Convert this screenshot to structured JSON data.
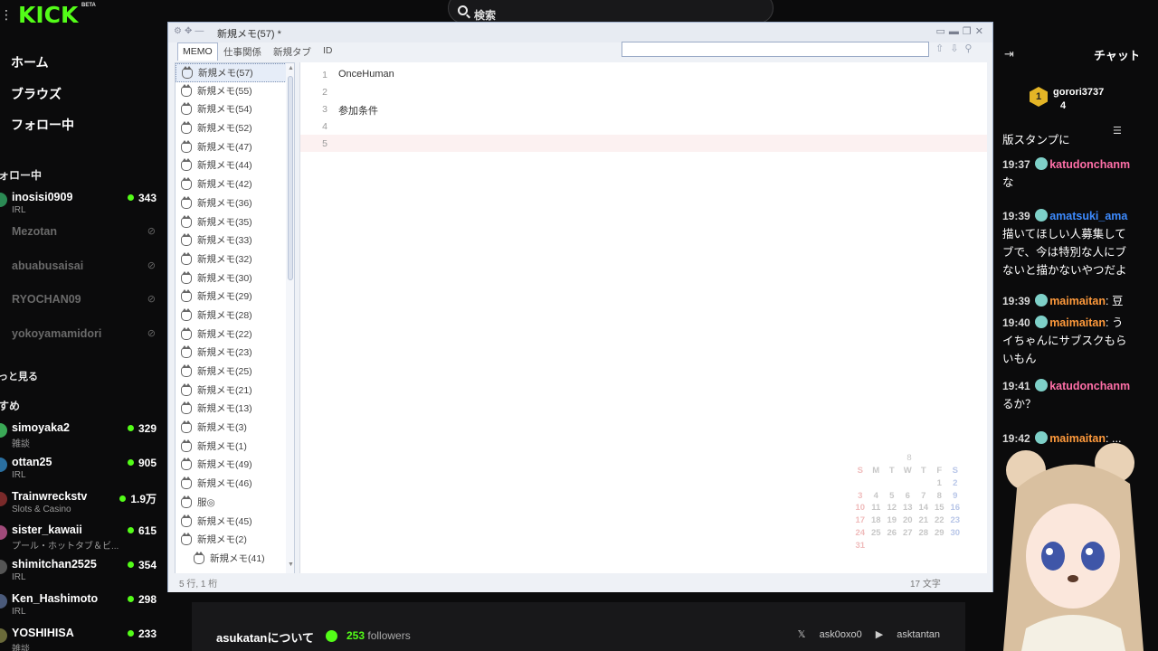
{
  "kick": {
    "logo": "KICK",
    "beta": "BETA",
    "nav": [
      "ホーム",
      "ブラウズ",
      "フォロー中"
    ],
    "following_title": "ォロー中",
    "following": [
      {
        "name": "inosisi0909",
        "category": "IRL",
        "viewers": "343",
        "live": true
      },
      {
        "name": "Mezotan",
        "live": false
      },
      {
        "name": "abuabusaisai",
        "live": false
      },
      {
        "name": "RYOCHAN09",
        "live": false
      },
      {
        "name": "yokoyamamidori",
        "live": false
      }
    ],
    "show_more": "っと見る",
    "recommended_title": "すめ",
    "recommended": [
      {
        "name": "simoyaka2",
        "category": "雑談",
        "viewers": "329"
      },
      {
        "name": "ottan25",
        "category": "IRL",
        "viewers": "905"
      },
      {
        "name": "Trainwreckstv",
        "category": "Slots & Casino",
        "viewers": "1.9万"
      },
      {
        "name": "sister_kawaii",
        "category": "プール・ホットタブ＆ビ...",
        "viewers": "615"
      },
      {
        "name": "shimitchan2525",
        "category": "IRL",
        "viewers": "354"
      },
      {
        "name": "Ken_Hashimoto",
        "category": "IRL",
        "viewers": "298"
      },
      {
        "name": "YOSHIHISA",
        "category": "雑談",
        "viewers": "233"
      }
    ],
    "search_placeholder": "検索"
  },
  "memo": {
    "window_title": "新規メモ(57) *",
    "tabs": [
      "MEMO",
      "仕事関係",
      "新規タブ",
      "ID"
    ],
    "notes": [
      "新規メモ(57)",
      "新規メモ(55)",
      "新規メモ(54)",
      "新規メモ(52)",
      "新規メモ(47)",
      "新規メモ(44)",
      "新規メモ(42)",
      "新規メモ(36)",
      "新規メモ(35)",
      "新規メモ(33)",
      "新規メモ(32)",
      "新規メモ(30)",
      "新規メモ(29)",
      "新規メモ(28)",
      "新規メモ(22)",
      "新規メモ(23)",
      "新規メモ(25)",
      "新規メモ(21)",
      "新規メモ(13)",
      "新規メモ(3)",
      "新規メモ(1)",
      "新規メモ(49)",
      "新規メモ(46)",
      "服◎",
      "新規メモ(45)",
      "新規メモ(2)",
      "新規メモ(41)"
    ],
    "lines": [
      {
        "num": "1",
        "text": "OnceHuman"
      },
      {
        "num": "2",
        "text": ""
      },
      {
        "num": "3",
        "text": "参加条件"
      },
      {
        "num": "4",
        "text": ""
      },
      {
        "num": "5",
        "text": ""
      }
    ],
    "calendar": {
      "month": "8",
      "weekdays": [
        "S",
        "M",
        "T",
        "W",
        "T",
        "F",
        "S"
      ],
      "weeks": [
        [
          "",
          "",
          "",
          "",
          "",
          "1",
          "2"
        ],
        [
          "3",
          "4",
          "5",
          "6",
          "7",
          "8",
          "9"
        ],
        [
          "10",
          "11",
          "12",
          "13",
          "14",
          "15",
          "16"
        ],
        [
          "17",
          "18",
          "19",
          "20",
          "21",
          "22",
          "23"
        ],
        [
          "24",
          "25",
          "26",
          "27",
          "28",
          "29",
          "30"
        ],
        [
          "31",
          "",
          "",
          "",
          "",
          "",
          ""
        ]
      ]
    },
    "status_position": "5 行, 1 桁",
    "status_chars": "17 文字"
  },
  "about": {
    "title": "asukatanについて",
    "followers_num": "253",
    "followers_label": "followers",
    "x_handle": "ask0oxo0",
    "youtube_handle": "asktantan"
  },
  "chat": {
    "title": "チャット",
    "gifter_name": "gorori3737",
    "gifter_rank": "1",
    "gifter_count": "4",
    "partial_line": "版スタンプに",
    "messages": [
      {
        "time": "19:37",
        "user": "katudonchanm",
        "color": "#ff6fa8",
        "sep": "",
        "text": "",
        "lines": [
          "な"
        ]
      },
      {
        "time": "19:39",
        "user": "amatsuki_ama",
        "color": "#3d8bff",
        "sep": "",
        "text": "",
        "lines": [
          "描いてほしい人募集して",
          "ブで、今は特別な人にブ",
          "ないと描かないやつだよ"
        ]
      },
      {
        "time": "19:39",
        "user": "maimaitan",
        "color": "#ff9a3c",
        "sep": ":",
        "text": "豆",
        "lines": []
      },
      {
        "time": "19:40",
        "user": "maimaitan",
        "color": "#ff9a3c",
        "sep": ":",
        "text": "う",
        "lines": [
          "イちゃんにサブスクもら",
          "いもん"
        ]
      },
      {
        "time": "19:41",
        "user": "katudonchanm",
        "color": "#ff6fa8",
        "sep": "",
        "text": "",
        "lines": [
          "るか？"
        ]
      },
      {
        "time": "19:42",
        "user": "maimaitan",
        "color": "#ff9a3c",
        "sep": ":",
        "text": "...",
        "lines": []
      }
    ]
  }
}
